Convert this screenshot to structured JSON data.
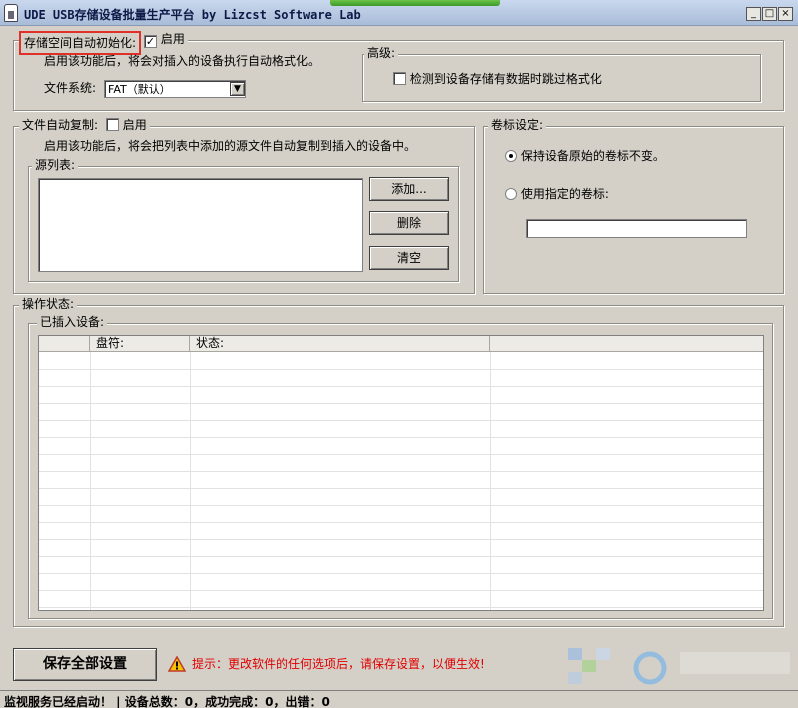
{
  "window": {
    "title": "UDE USB存储设备批量生产平台   by Lizcst Software Lab",
    "minimize_glyph": "_",
    "maximize_glyph": "□",
    "close_glyph": "×"
  },
  "format_group": {
    "legend": "存储空间自动初始化:",
    "enable_label": "启用",
    "enabled": true,
    "description": "启用该功能后，将会对插入的设备执行自动格式化。",
    "filesystem_label": "文件系统:",
    "filesystem_value": "FAT（默认）",
    "advanced": {
      "legend": "高级:",
      "skip_label": "检测到设备存储有数据时跳过格式化",
      "skip_checked": false
    }
  },
  "copy_group": {
    "legend": "文件自动复制:",
    "enable_label": "启用",
    "enabled": false,
    "description": "启用该功能后，将会把列表中添加的源文件自动复制到插入的设备中。",
    "source_legend": "源列表:",
    "add_button": "添加...",
    "delete_button": "删除",
    "clear_button": "清空"
  },
  "volume_group": {
    "legend": "卷标设定:",
    "keep_label": "保持设备原始的卷标不变。",
    "use_label": "使用指定的卷标:",
    "selected": "keep",
    "volume_value": ""
  },
  "status_group": {
    "legend": "操作状态:",
    "devices_legend": "已插入设备:",
    "columns": [
      "",
      "盘符:",
      "状态:",
      ""
    ]
  },
  "footer": {
    "save_button": "保存全部设置",
    "warning_icon": "warning-icon",
    "warning_text": "提示：更改软件的任何选项后，请保存设置，以便生效!",
    "warning_color": "#e00000"
  },
  "statusbar": {
    "text": "监视服务已经启动！  | 设备总数：0，成功完成：0，出错：0"
  },
  "colors": {
    "highlight_box": "#e0302a",
    "dialog_bg": "#d4d0c8"
  }
}
